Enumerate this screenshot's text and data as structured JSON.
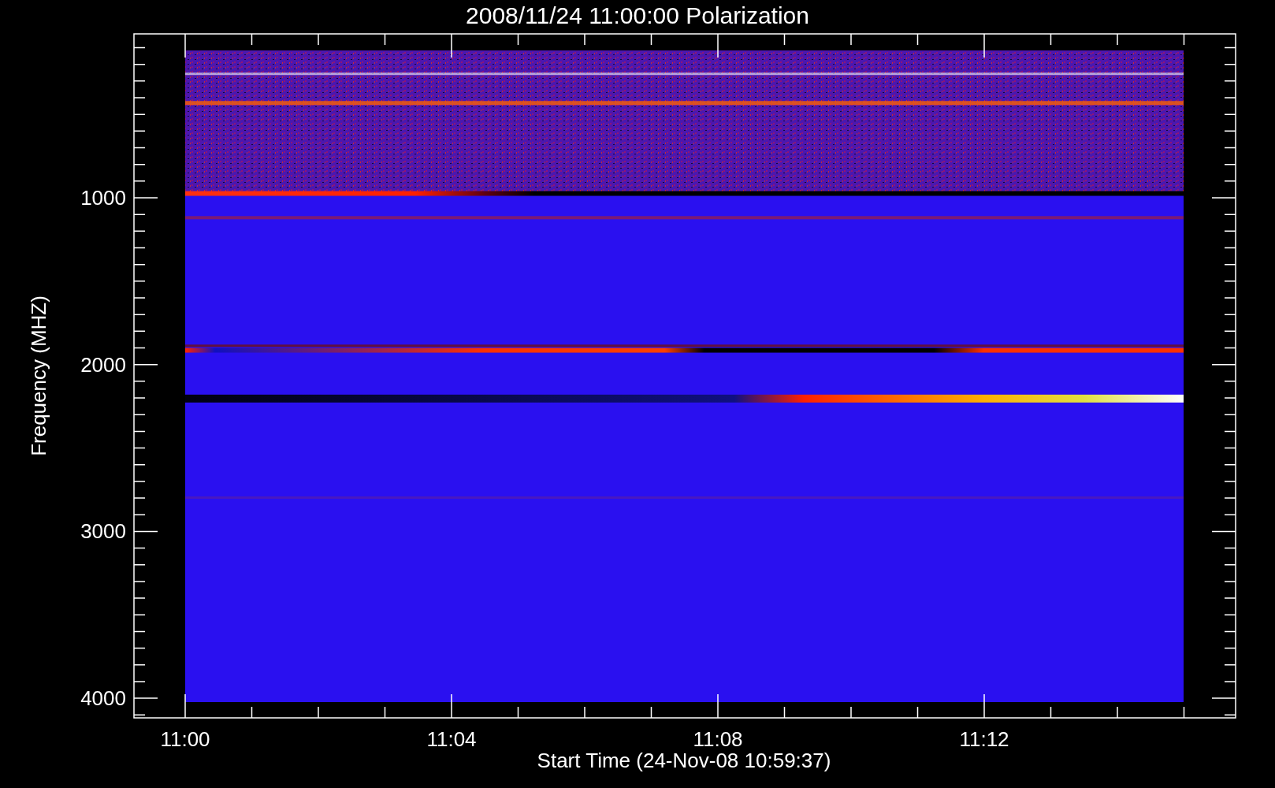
{
  "title": "2008/11/24 11:00:00 Polarization",
  "plot": {
    "ylabel": "Frequency (MHZ)",
    "xlabel": "Start Time (24-Nov-08 10:59:37)",
    "yticks": [
      "1000",
      "2000",
      "3000",
      "4000"
    ],
    "xticks": [
      "11:00",
      "11:04",
      "11:08",
      "11:12"
    ]
  }
}
